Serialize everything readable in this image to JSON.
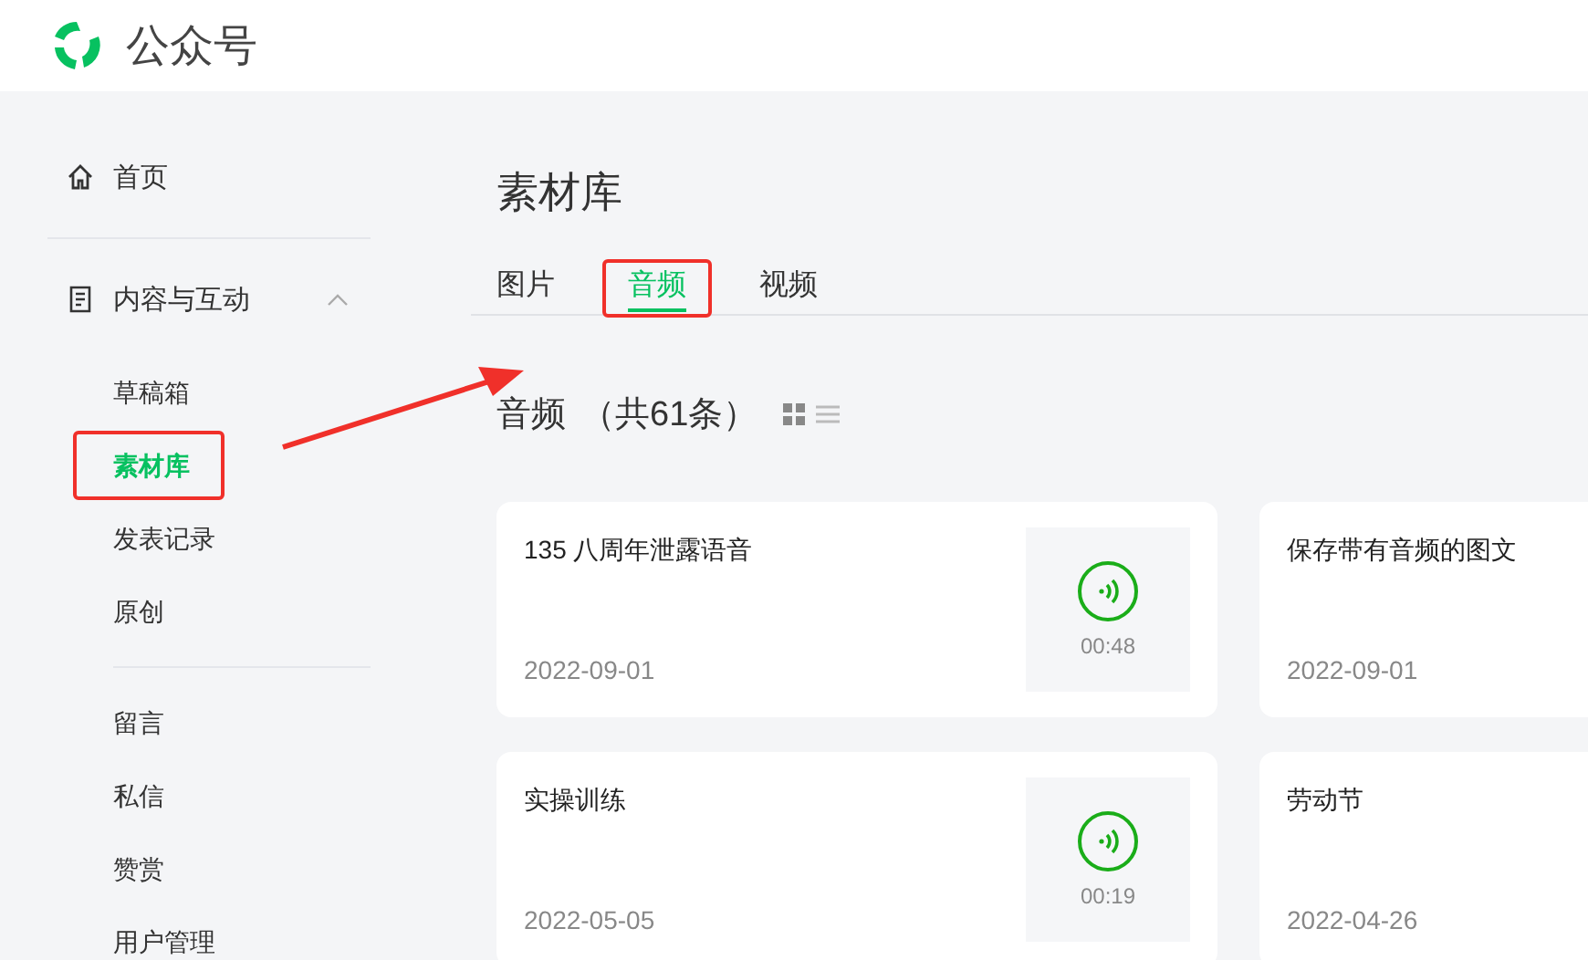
{
  "header": {
    "title": "公众号"
  },
  "sidebar": {
    "items": [
      {
        "label": "首页",
        "kind": "home",
        "selected": false,
        "highlighted": false
      },
      {
        "label": "内容与互动",
        "kind": "group",
        "expanded": true,
        "children": [
          {
            "label": "草稿箱",
            "selected": false,
            "highlighted": false
          },
          {
            "label": "素材库",
            "selected": true,
            "highlighted": true
          },
          {
            "label": "发表记录",
            "selected": false,
            "highlighted": false
          },
          {
            "label": "原创",
            "selected": false,
            "highlighted": false
          }
        ]
      },
      {
        "label": "留言",
        "kind": "plain",
        "selected": false,
        "highlighted": false
      },
      {
        "label": "私信",
        "kind": "plain",
        "selected": false,
        "highlighted": false
      },
      {
        "label": "赞赏",
        "kind": "plain",
        "selected": false,
        "highlighted": false
      },
      {
        "label": "用户管理",
        "kind": "plain",
        "selected": false,
        "highlighted": false
      }
    ]
  },
  "page_title": "素材库",
  "tabs": [
    {
      "label": "图片",
      "selected": false,
      "highlighted": false
    },
    {
      "label": "音频",
      "selected": true,
      "highlighted": true
    },
    {
      "label": "视频",
      "selected": false,
      "highlighted": false
    }
  ],
  "section": {
    "title": "音频",
    "count": "（共61条）",
    "view_modes": [
      {
        "kind": "grid",
        "selected": true
      },
      {
        "kind": "list",
        "selected": false
      }
    ]
  },
  "cards": [
    {
      "title": "135 八周年泄露语音",
      "date": "2022-09-01",
      "duration": "00:48"
    },
    {
      "title": "保存带有音频的图文",
      "date": "2022-09-01"
    },
    {
      "title": "实操训练",
      "date": "2022-05-05",
      "duration": "00:19"
    },
    {
      "title": "劳动节",
      "date": "2022-04-26"
    }
  ],
  "annotation_arrow": true
}
